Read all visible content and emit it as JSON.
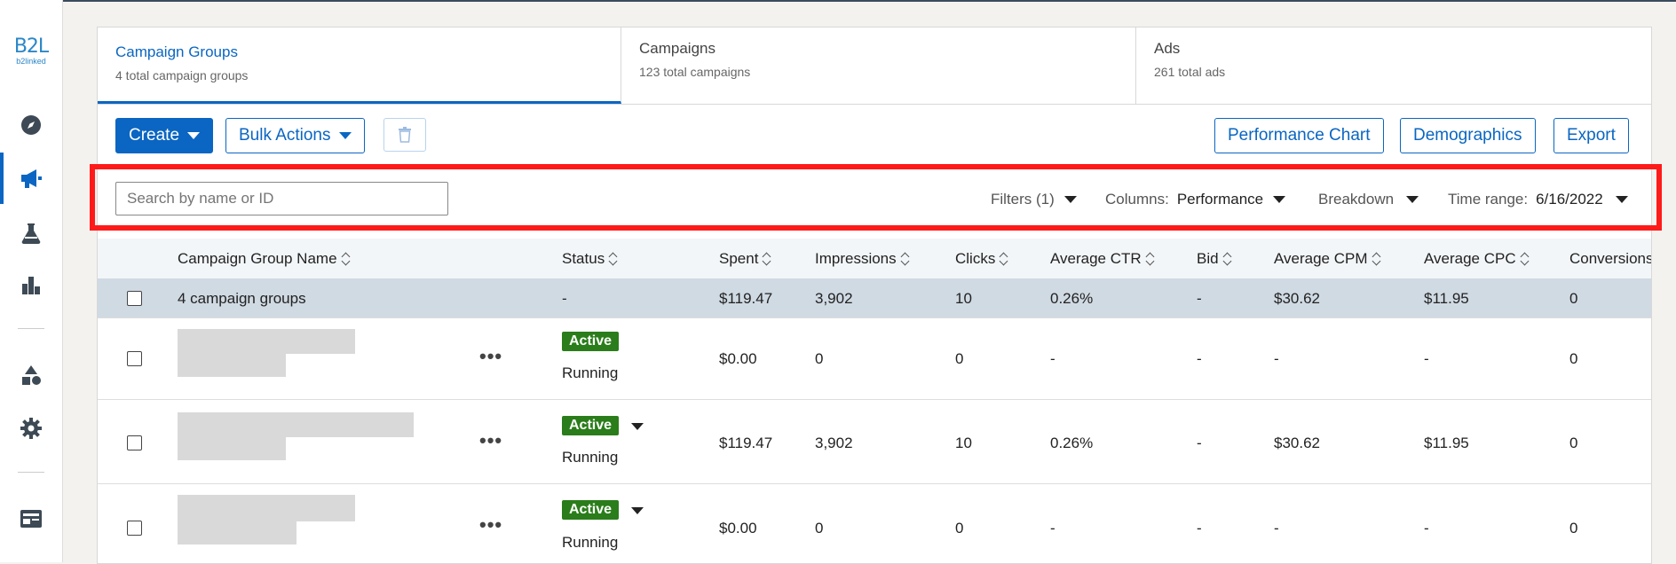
{
  "logo": {
    "big": "B2L",
    "small": "b2linked"
  },
  "tabs": [
    {
      "title": "Campaign Groups",
      "subtitle": "4 total campaign groups"
    },
    {
      "title": "Campaigns",
      "subtitle": "123 total campaigns"
    },
    {
      "title": "Ads",
      "subtitle": "261 total ads"
    }
  ],
  "toolbar": {
    "create": "Create",
    "bulk_actions": "Bulk Actions",
    "performance_chart": "Performance Chart",
    "demographics": "Demographics",
    "export": "Export"
  },
  "filters": {
    "search_placeholder": "Search by name or ID",
    "filters_label": "Filters (1)",
    "columns_label": "Columns:",
    "columns_value": "Performance",
    "breakdown_label": "Breakdown",
    "time_range_label": "Time range:",
    "time_range_value": "6/16/2022"
  },
  "table": {
    "headers": [
      "Campaign Group Name",
      "Status",
      "Spent",
      "Impressions",
      "Clicks",
      "Average CTR",
      "Bid",
      "Average CPM",
      "Average CPC",
      "Conversions"
    ],
    "summary": {
      "name": "4 campaign groups",
      "status": "-",
      "spent": "$119.47",
      "impressions": "3,902",
      "clicks": "10",
      "ctr": "0.26%",
      "bid": "-",
      "cpm": "$30.62",
      "cpc": "$11.95",
      "conversions": "0"
    },
    "rows": [
      {
        "status_badge": "Active",
        "status_text": "Running",
        "spent": "$0.00",
        "impressions": "0",
        "clicks": "0",
        "ctr": "-",
        "bid": "-",
        "cpm": "-",
        "cpc": "-",
        "conversions": "0"
      },
      {
        "status_badge": "Active",
        "status_text": "Running",
        "spent": "$119.47",
        "impressions": "3,902",
        "clicks": "10",
        "ctr": "0.26%",
        "bid": "-",
        "cpm": "$30.62",
        "cpc": "$11.95",
        "conversions": "0"
      },
      {
        "status_badge": "Active",
        "status_text": "Running",
        "spent": "$0.00",
        "impressions": "0",
        "clicks": "0",
        "ctr": "-",
        "bid": "-",
        "cpm": "-",
        "cpc": "-",
        "conversions": "0"
      }
    ],
    "row_menu": "•••"
  },
  "sidebar_icons": [
    "compass-icon",
    "megaphone-icon",
    "flask-icon",
    "bar-chart-icon",
    "shapes-icon",
    "gear-icon",
    "id-card-icon"
  ],
  "colors": {
    "accent": "#0a66c2",
    "active_badge": "#2a7d1a",
    "highlight": "#ff1a1a"
  }
}
